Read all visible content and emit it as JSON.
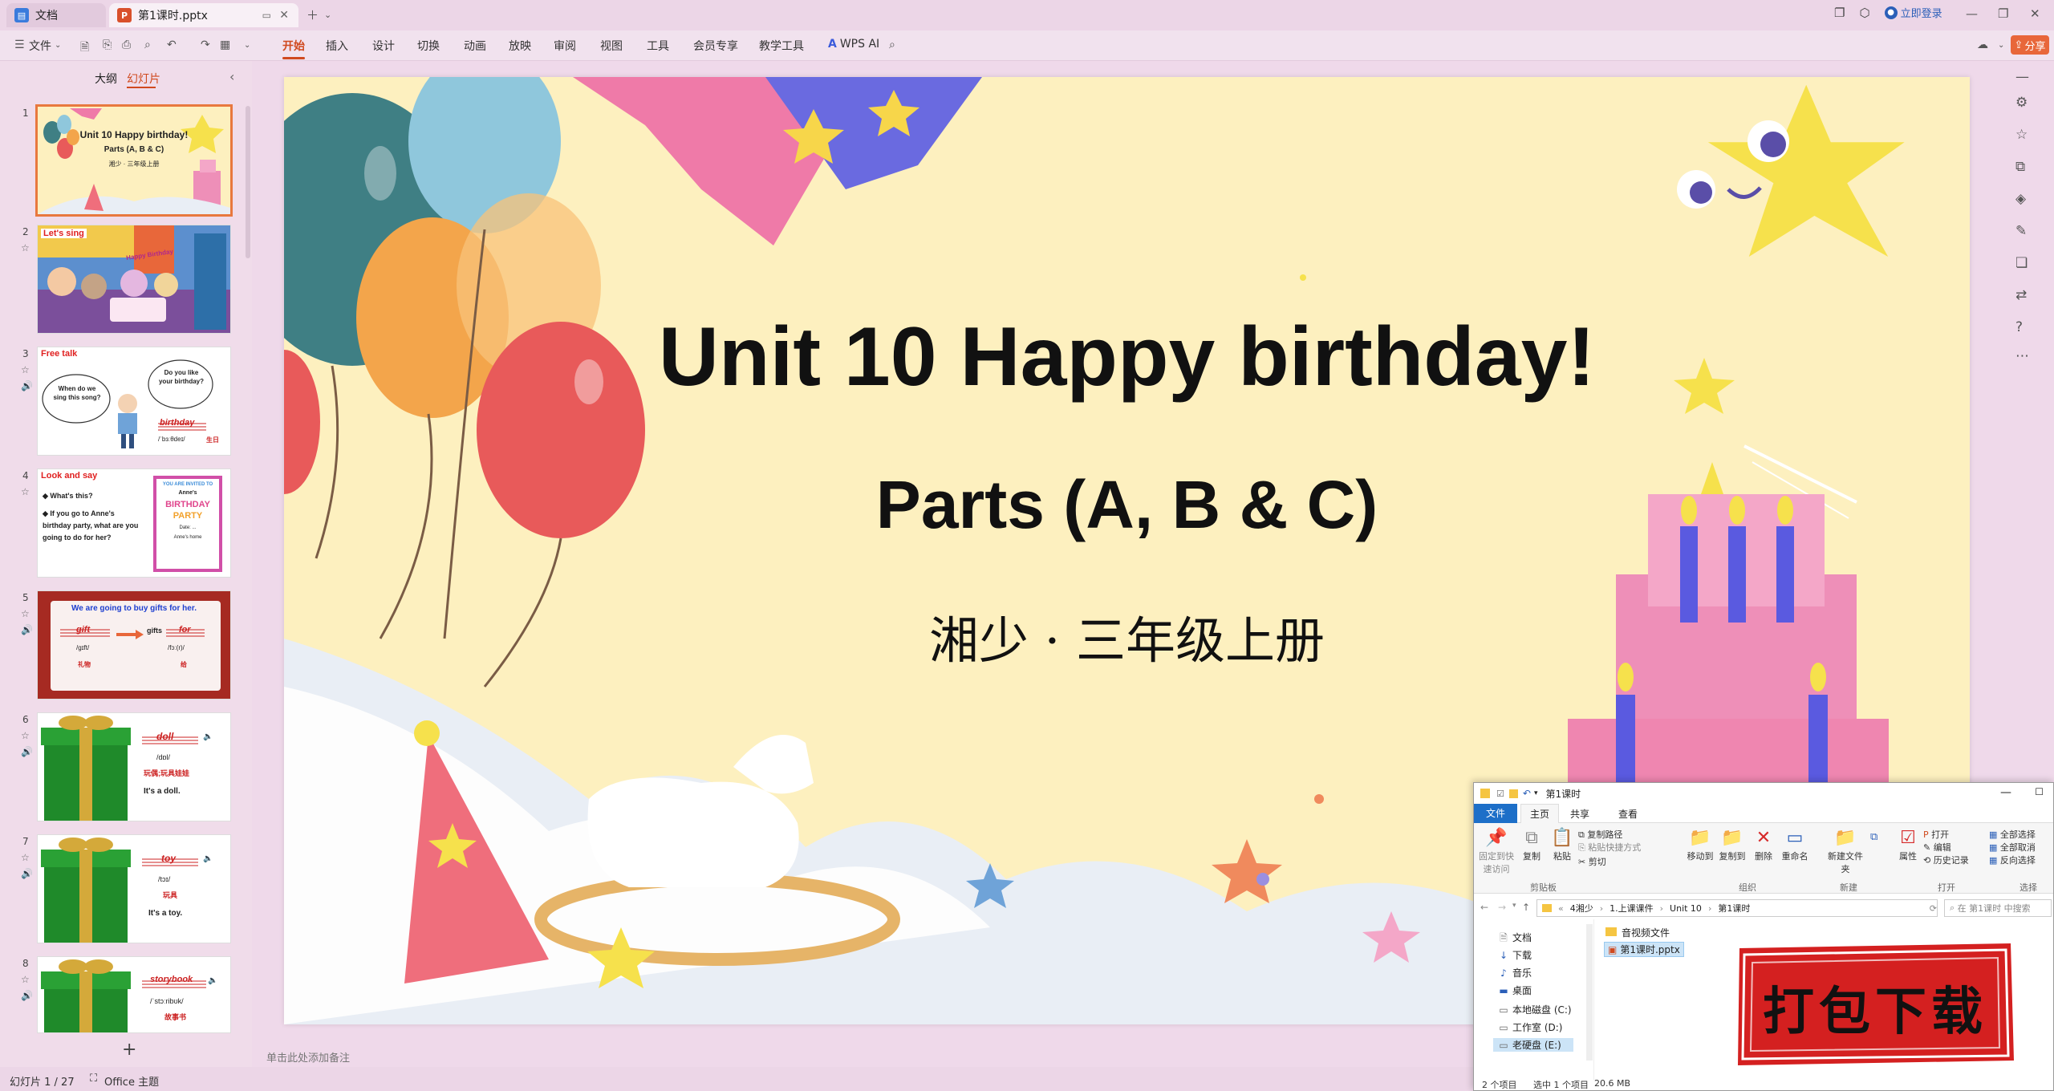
{
  "titlebar": {
    "tab_doc": "文档",
    "tab_ppt": "第1课时.pptx",
    "login": "立即登录"
  },
  "ribbon": {
    "file": "文件",
    "tabs": [
      "开始",
      "插入",
      "设计",
      "切换",
      "动画",
      "放映",
      "审阅",
      "视图",
      "工具",
      "会员专享",
      "教学工具"
    ],
    "wps_ai": "WPS AI",
    "share": "分享"
  },
  "leftpanel": {
    "tab_outline": "大纲",
    "tab_slides": "幻灯片",
    "slides": [
      {
        "num": "1",
        "title": "Unit 10 Happy birthday!",
        "sub": "Parts (A, B & C)",
        "grade": "湘少 · 三年级上册"
      },
      {
        "num": "2",
        "tag": "Let's sing",
        "banner": "Happy Birthday"
      },
      {
        "num": "3",
        "tag": "Free talk",
        "bubble1": "When do we sing this song?",
        "bubble2": "Do you like your birthday?",
        "word": "birthday",
        "phon": "/ˈbɜːθdeɪ/",
        "cn": "生日"
      },
      {
        "num": "4",
        "tag": "Look and say",
        "q1": "What's this?",
        "q2": "If you go to Anne's birthday party, what are you going to do for her?",
        "card1": "YOU ARE INVITED TO",
        "card2": "Anne's",
        "card3": "BIRTHDAY",
        "card4": "PARTY",
        "card5": "Date: ...",
        "card6": "Anne's home"
      },
      {
        "num": "5",
        "sentence": "We are going to buy gifts for her.",
        "w1": "gift",
        "p1": "/ɡɪft/",
        "c1": "礼物",
        "w2": "gifts",
        "w3": "for",
        "p3": "/fɔː(r)/",
        "c3": "给"
      },
      {
        "num": "6",
        "word": "doll",
        "phon": "/dɒl/",
        "cn": "玩偶;玩具娃娃",
        "sent": "It's a doll."
      },
      {
        "num": "7",
        "word": "toy",
        "phon": "/tɔɪ/",
        "cn": "玩具",
        "sent": "It's a toy."
      },
      {
        "num": "8",
        "word": "storybook",
        "phon": "/ˈstɔːribʊk/",
        "cn": "故事书"
      }
    ]
  },
  "slide": {
    "title": "Unit 10 Happy birthday!",
    "subtitle": "Parts (A, B & C)",
    "grade": "湘少 · 三年级上册"
  },
  "notes_placeholder": "单击此处添加备注",
  "status": {
    "slide_count": "幻灯片 1 / 27",
    "theme": "Office 主题"
  },
  "explorer": {
    "title": "第1课时",
    "tabs": [
      "文件",
      "主页",
      "共享",
      "查看"
    ],
    "ribbon": {
      "pin": "固定到快速访问",
      "copy": "复制",
      "paste": "粘贴",
      "copy_path": "复制路径",
      "paste_shortcut": "粘贴快捷方式",
      "cut": "剪切",
      "clipboard": "剪贴板",
      "move_to": "移动到",
      "copy_to": "复制到",
      "delete": "删除",
      "rename": "重命名",
      "organize": "组织",
      "new_folder": "新建文件夹",
      "new": "新建",
      "properties": "属性",
      "open": "打开",
      "edit": "编辑",
      "history": "历史记录",
      "open_group": "打开",
      "select_all": "全部选择",
      "select_none": "全部取消",
      "invert": "反向选择",
      "select_group": "选择"
    },
    "path": [
      "4湘少",
      "1.上课课件",
      "Unit 10",
      "第1课时"
    ],
    "search_placeholder": "在 第1课时 中搜索",
    "nav": [
      "文档",
      "下载",
      "音乐",
      "桌面",
      "本地磁盘 (C:)",
      "工作室 (D:)",
      "老硬盘 (E:)"
    ],
    "files": [
      "音视频文件",
      "第1课时.pptx"
    ],
    "status_items": "2 个项目",
    "status_selected": "选中 1 个项目",
    "status_size": "20.6 MB"
  },
  "download": {
    "label": "打包下载"
  }
}
